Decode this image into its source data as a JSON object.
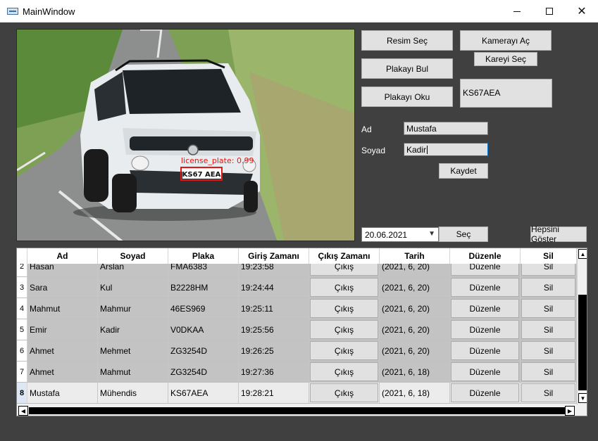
{
  "window": {
    "title": "MainWindow",
    "minimize_label": "—",
    "close_label": "✕"
  },
  "image_panel": {
    "detection_label": "license_plate: 0.99",
    "plate_text": "KS67 AEA"
  },
  "buttons": {
    "resim_sec": "Resim Seç",
    "kamera_ac": "Kamerayı Aç",
    "kareyi_sec": "Kareyi Seç",
    "plakayi_bul": "Plakayı Bul",
    "plakayi_oku": "Plakayı Oku",
    "kaydet": "Kaydet",
    "sec": "Seç",
    "hepsini_goster": "Hepsini Göster"
  },
  "plate_result": "KS67AEA",
  "form": {
    "ad_label": "Ad",
    "ad_value": "Mustafa",
    "soyad_label": "Soyad",
    "soyad_value": "Kadir"
  },
  "date_picker": {
    "value": "20.06.2021"
  },
  "table": {
    "columns": [
      "Ad",
      "Soyad",
      "Plaka",
      "Giriş Zamanı",
      "Çıkış Zamanı",
      "Tarih",
      "Düzenle",
      "Sil"
    ],
    "rows": [
      {
        "num": "2",
        "ad": "Hasan",
        "soyad": "Arslan",
        "plaka": "FMA6383",
        "giris": "19:23:58",
        "cikis": "Çıkış",
        "tarih": "(2021, 6, 20)",
        "duzenle": "Düzenle",
        "sil": "Sil"
      },
      {
        "num": "3",
        "ad": "Sara",
        "soyad": "Kul",
        "plaka": "B2228HM",
        "giris": "19:24:44",
        "cikis": "Çıkış",
        "tarih": "(2021, 6, 20)",
        "duzenle": "Düzenle",
        "sil": "Sil"
      },
      {
        "num": "4",
        "ad": "Mahmut",
        "soyad": "Mahmur",
        "plaka": "46ES969",
        "giris": "19:25:11",
        "cikis": "Çıkış",
        "tarih": "(2021, 6, 20)",
        "duzenle": "Düzenle",
        "sil": "Sil"
      },
      {
        "num": "5",
        "ad": "Emir",
        "soyad": "Kadir",
        "plaka": "V0DKAA",
        "giris": "19:25:56",
        "cikis": "Çıkış",
        "tarih": "(2021, 6, 20)",
        "duzenle": "Düzenle",
        "sil": "Sil"
      },
      {
        "num": "6",
        "ad": "Ahmet",
        "soyad": "Mehmet",
        "plaka": "ZG3254D",
        "giris": "19:26:25",
        "cikis": "Çıkış",
        "tarih": "(2021, 6, 20)",
        "duzenle": "Düzenle",
        "sil": "Sil"
      },
      {
        "num": "7",
        "ad": "Ahmet",
        "soyad": "Mahmut",
        "plaka": "ZG3254D",
        "giris": "19:27:36",
        "cikis": "Çıkış",
        "tarih": "(2021, 6, 18)",
        "duzenle": "Düzenle",
        "sil": "Sil"
      },
      {
        "num": "8",
        "ad": "Mustafa",
        "soyad": "Mühendis",
        "plaka": "KS67AEA",
        "giris": "19:28:21",
        "cikis": "Çıkış",
        "tarih": "(2021, 6, 18)",
        "duzenle": "Düzenle",
        "sil": "Sil"
      }
    ]
  },
  "colors": {
    "window_bg": "#404040",
    "button_bg": "#e1e1e1",
    "detection_red": "#e01818",
    "focus_blue": "#0078d7"
  }
}
